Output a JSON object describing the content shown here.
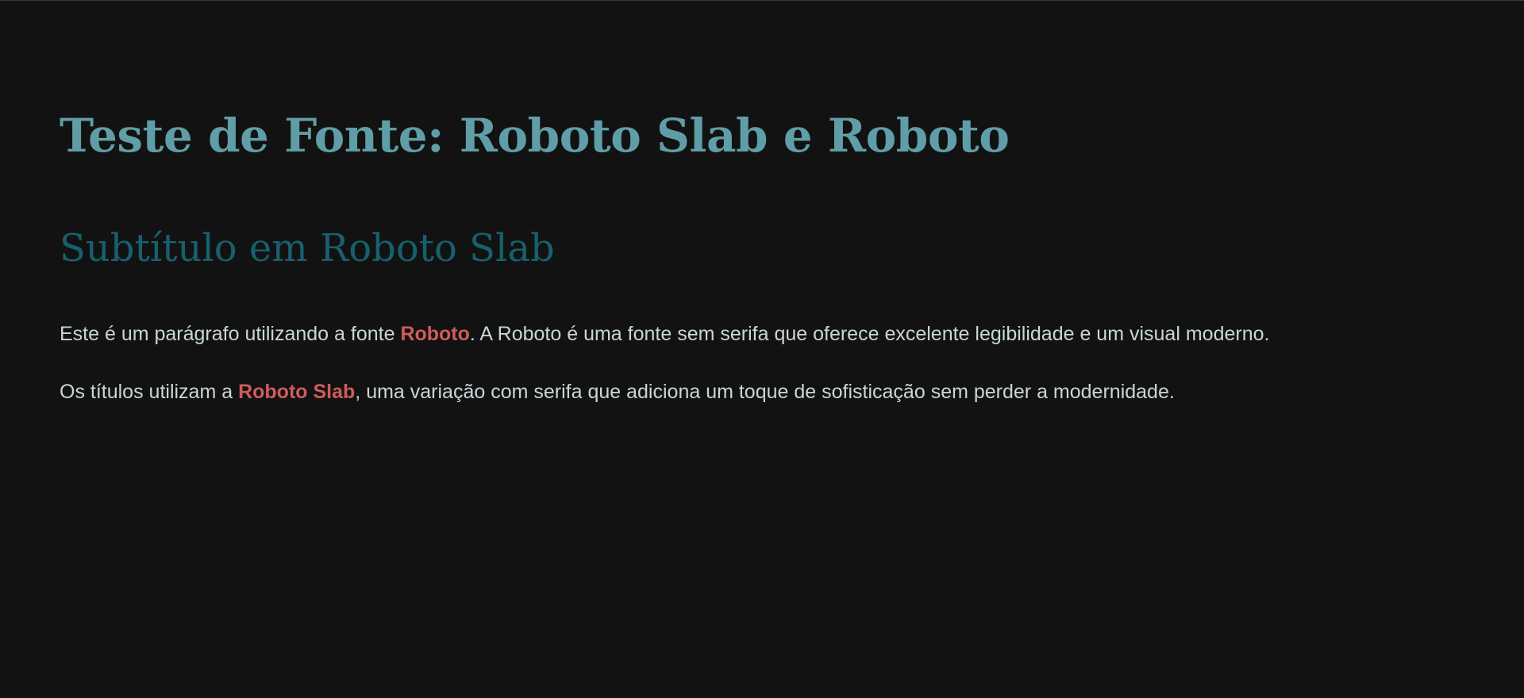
{
  "colors": {
    "background": "#121212",
    "title": "#5f9ea6",
    "subtitle": "#17606d",
    "body_text": "#c9d6d8",
    "emphasis": "#cd5c5c"
  },
  "heading": {
    "title": "Teste de Fonte: Roboto Slab e Roboto",
    "subtitle": "Subtítulo em Roboto Slab"
  },
  "paragraphs": [
    {
      "before": "Este é um parágrafo utilizando a fonte ",
      "emphasis": "Roboto",
      "after": ". A Roboto é uma fonte sem serifa que oferece excelente legibilidade e um visual moderno."
    },
    {
      "before": "Os títulos utilizam a ",
      "emphasis": "Roboto Slab",
      "after": ", uma variação com serifa que adiciona um toque de sofisticação sem perder a modernidade."
    }
  ]
}
